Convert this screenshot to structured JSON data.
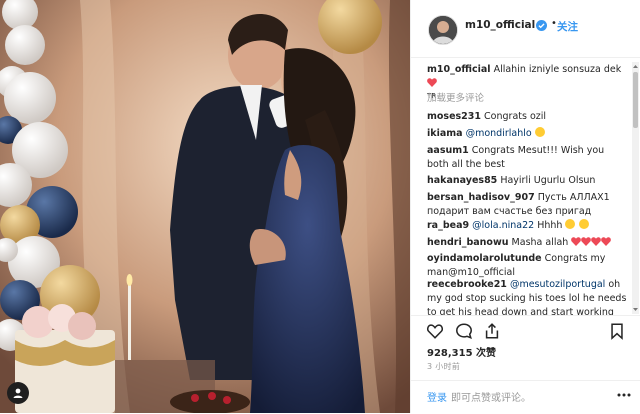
{
  "post": {
    "username": "m10_official",
    "follow_label": "关注",
    "separator": "•"
  },
  "caption": {
    "username": "m10_official",
    "text": "Allahin izniyle sonsuza dek",
    "suffix": "TR"
  },
  "load_more": "加载更多评论",
  "comments": [
    {
      "user": "moses231",
      "text": "Congrats ozil"
    },
    {
      "user": "ikiama",
      "mention": "@mondirlahlo",
      "text": ""
    },
    {
      "user": "aasum1",
      "text": "Congrats Mesut!!! Wish you both all the best"
    },
    {
      "user": "hakanayes85",
      "text": "Hayirli Ugurlu Olsun"
    },
    {
      "user": "bersan_hadisov_907",
      "text": "Пусть АЛЛАХ1 подарит вам счастье без пригад"
    },
    {
      "user": "ra_bea9",
      "mention": "@lola.nina22",
      "text": "Hhhh"
    },
    {
      "user": "hendri_banowu",
      "text": "Masha allah"
    },
    {
      "user": "oyindamolarolutunde",
      "text": "Congrats my man@m10_official"
    },
    {
      "user": "reecebrooke21",
      "mention": "@mesutozilportugal",
      "text": "oh my god stop sucking his toes lol he needs to get his head down and start working"
    }
  ],
  "likes": {
    "count": "928,315",
    "label": "次赞"
  },
  "time_ago": "3 小时前",
  "login": {
    "link": "登录",
    "rest": "即可点赞或评论。"
  },
  "icons": [
    "heart-icon",
    "comment-icon",
    "share-icon",
    "bookmark-icon",
    "more-icon",
    "verified-icon",
    "user-tag-icon"
  ],
  "colors": {
    "accent": "#3897f0",
    "text": "#262626",
    "muted": "#999999",
    "heart": "#ed4956"
  }
}
